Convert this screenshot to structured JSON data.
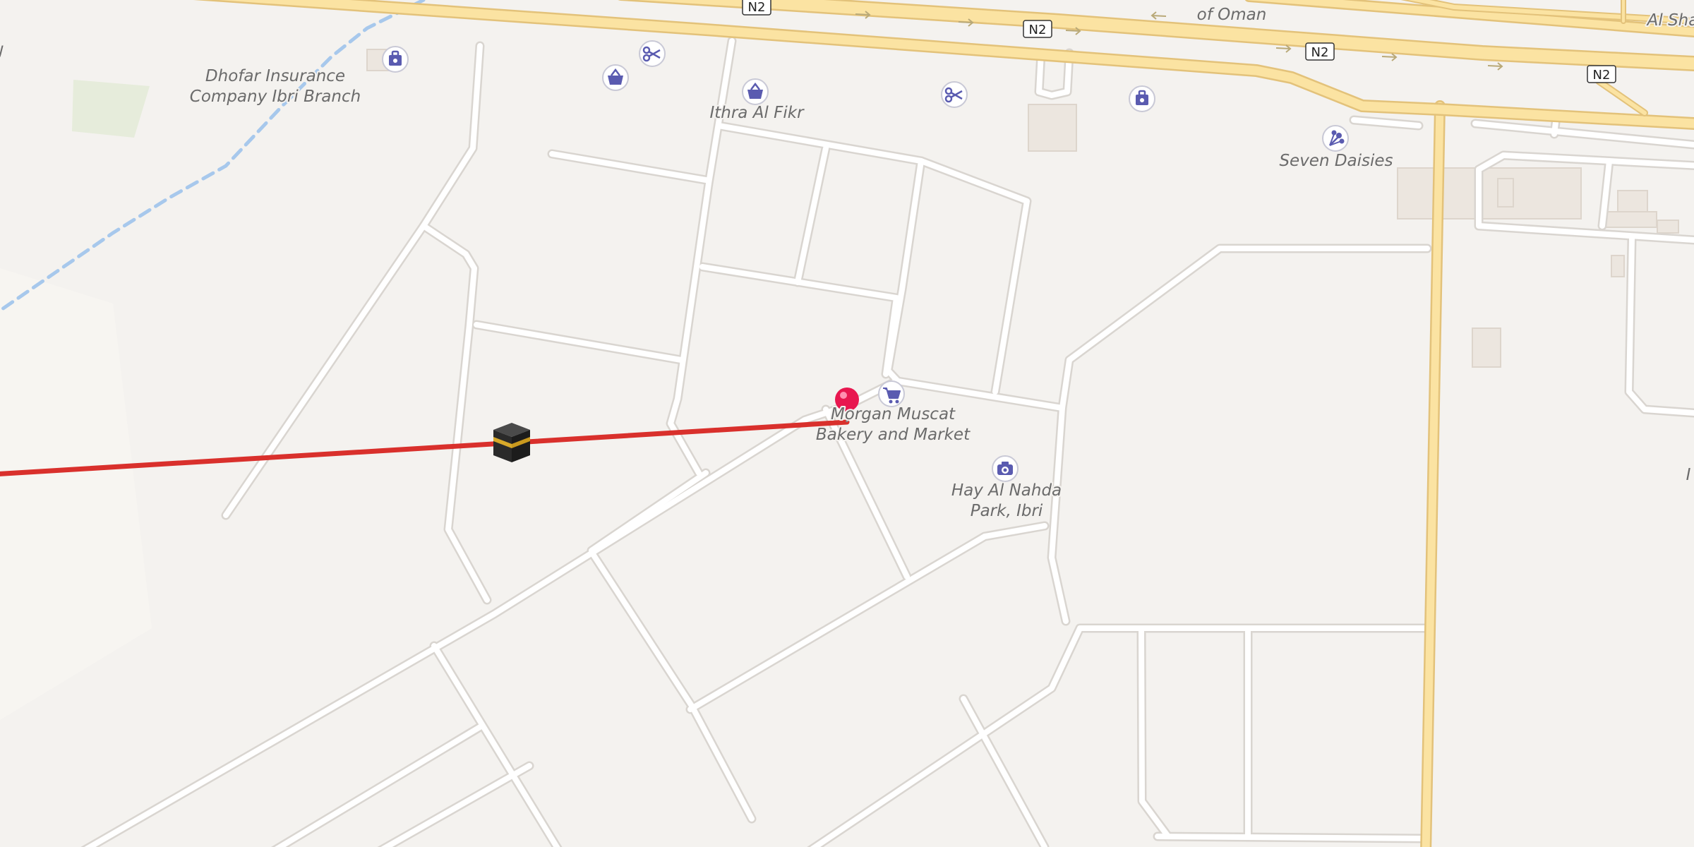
{
  "map": {
    "colors": {
      "land": "#f4f2ef",
      "minor_road": "#ffffff",
      "road_casing": "#d9d5d0",
      "highway_fill": "#fbe3a2",
      "highway_casing": "#e3c27a",
      "route_line": "#d9302c",
      "waterway": "#a7c8ec",
      "park": "#e6ecdb",
      "building": "#ece6df",
      "poi_icon": "#5a5bb0",
      "pin": "#e8174f"
    },
    "road_shields": [
      {
        "ref": "N2"
      },
      {
        "ref": "N2"
      },
      {
        "ref": "N2"
      },
      {
        "ref": "N2"
      }
    ],
    "labels": {
      "oman_partial": "of Oman",
      "al_sha_partial": "Al Sha",
      "right_edge_partial": "I",
      "left_edge_partial": "ل",
      "dhofar_line1": "Dhofar Insurance",
      "dhofar_line2": "Company Ibri Branch",
      "ithra": "Ithra Al Fikr",
      "seven_daisies": "Seven Daisies",
      "morgan_line1": "Morgan Muscat",
      "morgan_line2": "Bakery and Market",
      "park_line1": "Hay Al Nahda",
      "park_line2": "Park, Ibri"
    },
    "pois": [
      {
        "type": "insurance",
        "icon": "briefcase-icon"
      },
      {
        "type": "shop",
        "icon": "basket-icon"
      },
      {
        "type": "hairdresser",
        "icon": "scissors-icon"
      },
      {
        "type": "shop",
        "icon": "basket-icon"
      },
      {
        "type": "hairdresser",
        "icon": "scissors-icon"
      },
      {
        "type": "insurance",
        "icon": "briefcase-icon"
      },
      {
        "type": "florist",
        "icon": "flower-icon"
      },
      {
        "type": "supermarket",
        "icon": "cart-icon"
      },
      {
        "type": "viewpoint",
        "icon": "camera-icon"
      },
      {
        "type": "qibla",
        "icon": "kaaba-icon"
      },
      {
        "type": "location",
        "icon": "location-pin-icon"
      }
    ]
  }
}
